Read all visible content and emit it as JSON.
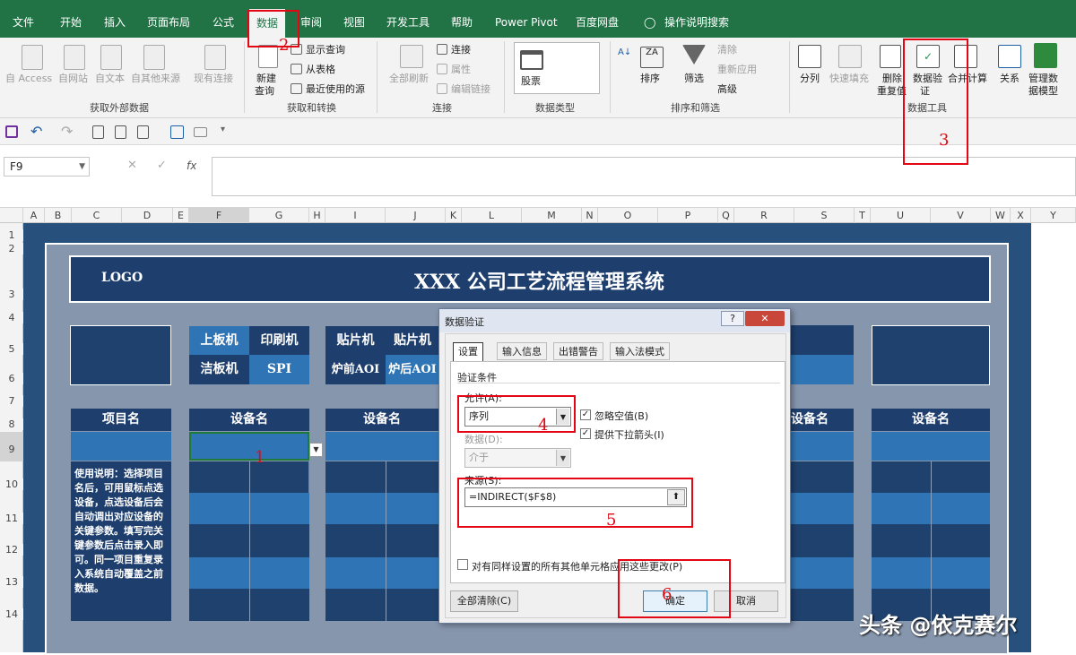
{
  "menu_tabs": [
    "文件",
    "开始",
    "插入",
    "页面布局",
    "公式",
    "数据",
    "审阅",
    "视图",
    "开发工具",
    "帮助",
    "Power Pivot",
    "百度网盘"
  ],
  "tell_me": "操作说明搜索",
  "ribbon": {
    "get_data": {
      "access": "自 Access",
      "web": "自网站",
      "text": "自文本",
      "other": "自其他来源",
      "existing": "现有连接",
      "label": "获取外部数据"
    },
    "transform": {
      "new_query_1": "新建",
      "new_query_2": "查询",
      "show_queries": "显示查询",
      "from_table": "从表格",
      "recent": "最近使用的源",
      "label": "获取和转换"
    },
    "connections": {
      "refresh_all": "全部刷新",
      "connections": "连接",
      "properties": "属性",
      "edit_links": "编辑链接",
      "label": "连接"
    },
    "data_types": {
      "stocks": "股票",
      "label": "数据类型"
    },
    "sort_filter": {
      "sort": "排序",
      "filter": "筛选",
      "clear": "清除",
      "reapply": "重新应用",
      "advanced": "高级",
      "label": "排序和筛选"
    },
    "data_tools": {
      "split": "分列",
      "flash_fill": "快速填充",
      "remove_dup_1": "删除",
      "remove_dup_2": "重复值",
      "validation_1": "数据验",
      "validation_2": "证",
      "consolidate": "合并计算",
      "relations": "关系",
      "data_model_1": "管理数",
      "data_model_2": "据模型",
      "label": "数据工具"
    }
  },
  "name_box": "F9",
  "fx": "fx",
  "columns": [
    "A",
    "B",
    "C",
    "D",
    "E",
    "F",
    "G",
    "H",
    "I",
    "J",
    "K",
    "L",
    "M",
    "N",
    "O",
    "P",
    "Q",
    "R",
    "S",
    "T",
    "U",
    "V",
    "W",
    "X",
    "Y"
  ],
  "rows": [
    "1",
    "2",
    "3",
    "4",
    "5",
    "6",
    "7",
    "8",
    "9",
    "10",
    "11",
    "12",
    "13",
    "14"
  ],
  "sheet": {
    "logo": "LOGO",
    "title": "XXX 公司工艺流程管理系统",
    "machines_a": [
      "上板机",
      "印刷机",
      "洁板机",
      "SPI"
    ],
    "machines_b": [
      "贴片机",
      "贴片机",
      "炉前AOI",
      "炉后AOI"
    ],
    "project_header": "项目名",
    "device_header": "设备名",
    "instructions": "使用说明：选择项目名后，可用鼠标点选设备，点选设备后会自动调出对应设备的关键参数。填写完关键参数后点击录入即可。同一项目重复录入系统自动覆盖之前数据。"
  },
  "dialog": {
    "title": "数据验证",
    "help": "?",
    "close": "✕",
    "tabs": [
      "设置",
      "输入信息",
      "出错警告",
      "输入法模式"
    ],
    "criteria_label": "验证条件",
    "allow_label": "允许(A):",
    "allow_value": "序列",
    "ignore_blank": "忽略空值(B)",
    "dropdown": "提供下拉箭头(I)",
    "data_label": "数据(D):",
    "data_value": "介于",
    "source_label": "来源(S):",
    "source_value": "=INDIRECT($F$8)",
    "apply_all": "对有同样设置的所有其他单元格应用这些更改(P)",
    "clear_all": "全部清除(C)",
    "ok": "确定",
    "cancel": "取消"
  },
  "annotations": [
    "1",
    "2",
    "3",
    "4",
    "5",
    "6"
  ],
  "watermark": "头条 @依克赛尔"
}
